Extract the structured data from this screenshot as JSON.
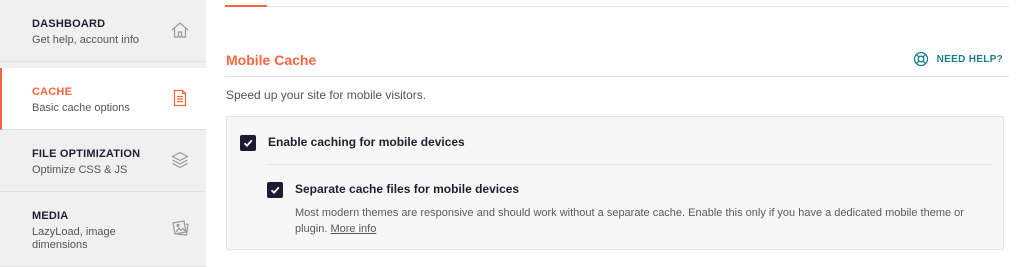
{
  "sidebar": {
    "items": [
      {
        "title": "DASHBOARD",
        "subtitle": "Get help, account info",
        "icon": "house-icon"
      },
      {
        "title": "CACHE",
        "subtitle": "Basic cache options",
        "icon": "document-icon"
      },
      {
        "title": "FILE OPTIMIZATION",
        "subtitle": "Optimize CSS & JS",
        "icon": "layers-icon"
      },
      {
        "title": "MEDIA",
        "subtitle": "LazyLoad, image dimensions",
        "icon": "images-icon"
      }
    ],
    "active_index": 1
  },
  "main": {
    "section_title": "Mobile Cache",
    "help_label": "NEED HELP?",
    "section_description": "Speed up your site for mobile visitors.",
    "options": [
      {
        "label": "Enable caching for mobile devices",
        "checked": true
      },
      {
        "label": "Separate cache files for mobile devices",
        "checked": true,
        "description": "Most modern themes are responsive and should work without a separate cache. Enable this only if you have a dedicated mobile theme or plugin.",
        "link_text": "More info"
      }
    ]
  },
  "colors": {
    "accent": "#f56640",
    "help": "#1b7f8f",
    "checkbox": "#1f1a33",
    "sidebar_bg": "#f0f0f0"
  }
}
